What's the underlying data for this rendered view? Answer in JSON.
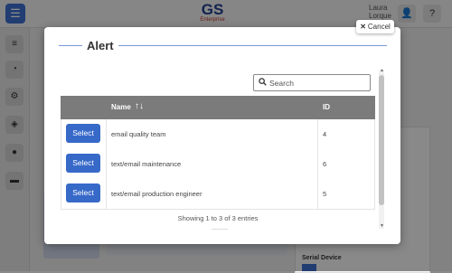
{
  "header": {
    "logo_main": "GS",
    "logo_sub": "Enterprise",
    "user_name": "Laura",
    "user_sub": "Lorque"
  },
  "background": {
    "serial_label": "Serial Device"
  },
  "modal": {
    "title": "Alert",
    "cancel_label": "Cancel",
    "search_placeholder": "Search",
    "columns": {
      "name": "Name",
      "sort_icon": "↑↓",
      "id": "ID"
    },
    "select_label": "Select",
    "rows": [
      {
        "name": "email quality team",
        "id": "4"
      },
      {
        "name": "text/email maintenance",
        "id": "6"
      },
      {
        "name": "text/email production engineer",
        "id": "5"
      }
    ],
    "info_text": "Showing 1 to 3 of 3 entries"
  },
  "colors": {
    "accent": "#3769c9",
    "header_bg": "#7b7b7b",
    "title_rule": "#7a9bd4"
  }
}
